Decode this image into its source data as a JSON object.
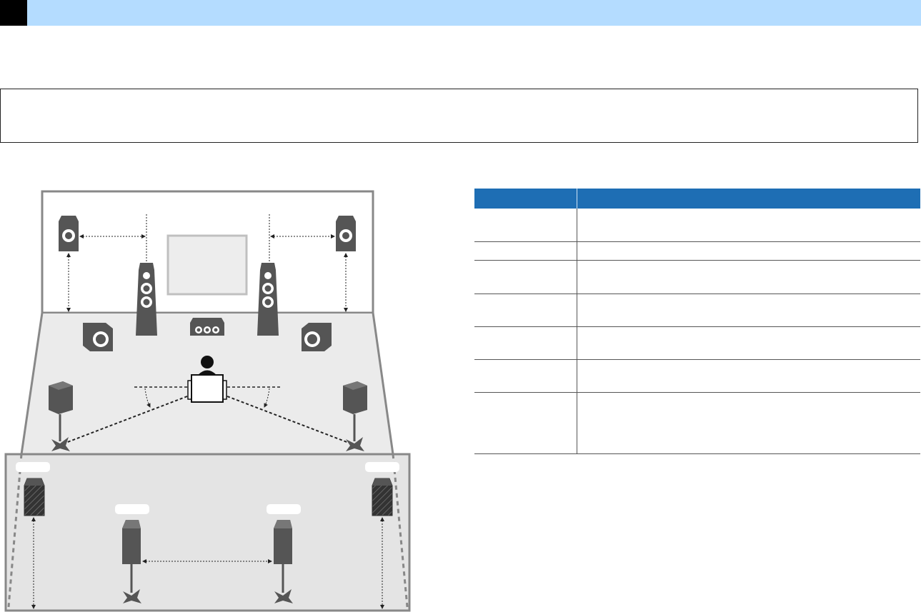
{
  "colors": {
    "header_bar": "#b4dcff",
    "table_header": "#1e6eb4",
    "speaker_fill": "#555555",
    "floor_fill": "#ebebeb",
    "lower_panel_fill": "#e4e4e4"
  },
  "icons": [
    "speaker-icon",
    "tower-speaker-icon",
    "center-speaker-icon",
    "subwoofer-icon",
    "tv-screen-icon",
    "listener-icon",
    "chair-icon",
    "ceiling-speaker-icon"
  ],
  "table": {
    "headers": [
      "",
      ""
    ],
    "rows": [
      {
        "c1": "",
        "c2": ""
      },
      {
        "c1": "",
        "c2": ""
      },
      {
        "c1": "",
        "c2": ""
      },
      {
        "c1": "",
        "c2": ""
      },
      {
        "c1": "",
        "c2": ""
      },
      {
        "c1": "",
        "c2": ""
      },
      {
        "c1": "",
        "c2": ""
      }
    ]
  }
}
